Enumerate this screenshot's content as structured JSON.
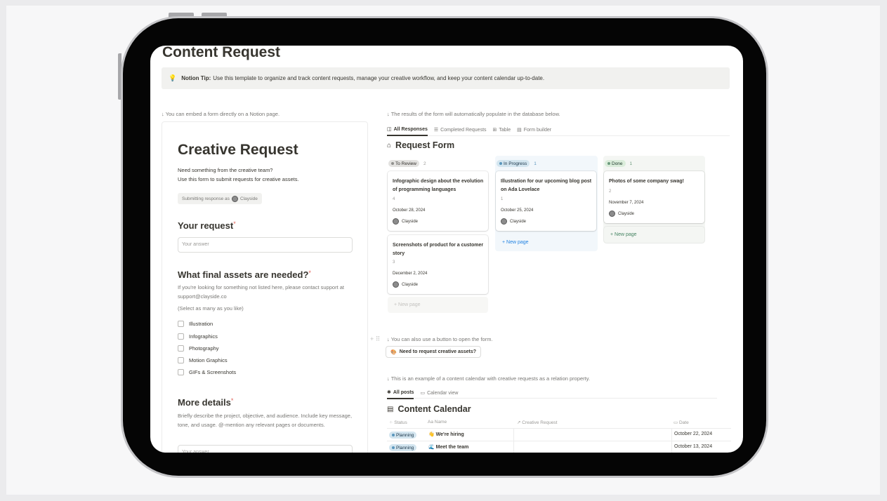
{
  "page": {
    "title": "Content Request",
    "tip_label": "Notion Tip:",
    "tip_text": "Use this template to organize and track content requests, manage your creative workflow, and keep your content calendar up-to-date.",
    "note_form": "↓ You can embed a form directly on a Notion page.",
    "note_results": "↓ The results of the form will automatically populate in the database below.",
    "note_button": "↓ You can also use a button to open the form.",
    "note_calendar": "↓ This is an example of a content calendar with creative requests as a relation property."
  },
  "form": {
    "title": "Creative Request",
    "subtitle_1": "Need something from the creative team?",
    "subtitle_2": "Use this form to submit requests for creative assets.",
    "submitting_label": "Submitting response as",
    "user": "Clayside",
    "q1_title": "Your request",
    "q1_placeholder": "Your answer",
    "q2_title": "What final assets are needed?",
    "q2_help": "If you're looking for something not listed here, please contact support at support@clayside.co",
    "q2_hint": "(Select as many as you like)",
    "q2_options": [
      "Illustration",
      "Infographics",
      "Photography",
      "Motion Graphics",
      "GIFs & Screenshots"
    ],
    "q3_title": "More details",
    "q3_help": "Briefly describe the project, objective, and audience. Include key message, tone, and usage. @-mention any relevant pages or documents.",
    "q3_placeholder": "Your answer",
    "required_mark": "*"
  },
  "views": {
    "tabs": [
      "All Responses",
      "Completed Requests",
      "Table",
      "Form builder"
    ]
  },
  "board": {
    "title": "Request Form",
    "columns": [
      {
        "status": "To Review",
        "count": "2",
        "cards": [
          {
            "title": "Infographic design about the evolution of programming languages",
            "num": "4",
            "date": "October 28, 2024",
            "user": "Clayside"
          },
          {
            "title": "Screenshots of product for a customer story",
            "num": "3",
            "date": "December 2, 2024",
            "user": "Clayside"
          }
        ],
        "new_page": "+ New page"
      },
      {
        "status": "In Progress",
        "count": "1",
        "cards": [
          {
            "title": "Illustration for our upcoming blog post on Ada Lovelace",
            "num": "1",
            "date": "October 25, 2024",
            "user": "Clayside"
          }
        ],
        "new_page": "+ New page"
      },
      {
        "status": "Done",
        "count": "1",
        "cards": [
          {
            "title": "Photos of some company swag!",
            "num": "2",
            "date": "November 7, 2024",
            "user": "Clayside"
          }
        ],
        "new_page": "+ New page"
      }
    ]
  },
  "button_label": "Need to request creative assets?",
  "calendar": {
    "tabs": [
      "All posts",
      "Calendar view"
    ],
    "title": "Content Calendar",
    "columns": [
      "Status",
      "Name",
      "Creative Request",
      "Date"
    ],
    "rows": [
      {
        "status": "Planning",
        "icon": "👋",
        "name": "We're hiring",
        "date": "October 22, 2024"
      },
      {
        "status": "Planning",
        "icon": "🌊",
        "name": "Meet the team",
        "date": "October 13, 2024"
      }
    ]
  },
  "colors": {
    "to_review_badge": "#e3e2e0",
    "in_progress_badge": "#d3e5ef",
    "done_badge": "#dbeddb",
    "new_page_blue": "#2383e2",
    "new_page_green": "#448361"
  }
}
